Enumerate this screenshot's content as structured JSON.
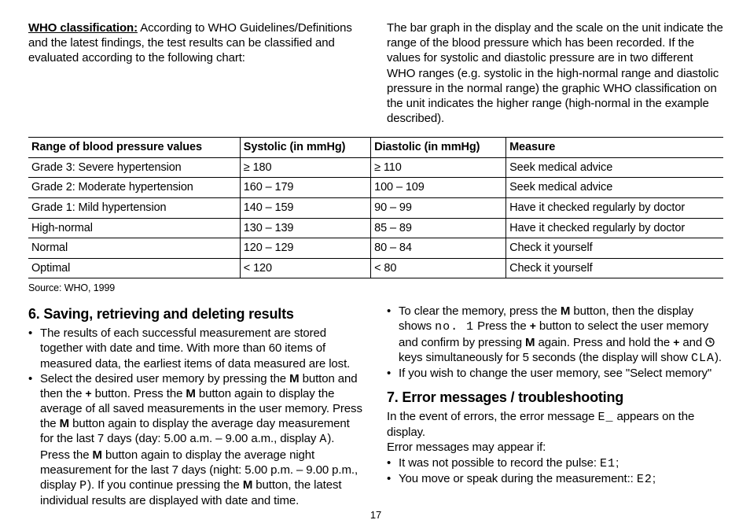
{
  "intro": {
    "who_heading": "WHO classification:",
    "who_body": "According to WHO Guidelines/Definitions and the latest findings, the test results can be classified and evaluated according to the following chart:",
    "right_body": "The bar graph in the display and the scale on the unit indicate the range of the blood pressure which has been recorded. If the values for systolic and diastolic pressure are in two different WHO ranges (e.g. systolic in the high-normal range and diastolic pressure in the normal range) the graphic WHO classification on the unit indicates the higher range (high-normal in the example described)."
  },
  "table": {
    "headers": {
      "range": "Range of blood pressure values",
      "systolic": "Systolic (in mmHg)",
      "diastolic": "Diastolic (in mmHg)",
      "measure": "Measure"
    },
    "rows": [
      {
        "range": "Grade 3: Severe hypertension",
        "systolic": "≥ 180",
        "diastolic": "≥ 110",
        "measure": "Seek medical advice"
      },
      {
        "range": "Grade 2: Moderate hypertension",
        "systolic": "160 – 179",
        "diastolic": "100 – 109",
        "measure": "Seek medical advice"
      },
      {
        "range": "Grade 1: Mild hypertension",
        "systolic": "140 – 159",
        "diastolic": "90 – 99",
        "measure": "Have it checked regularly by doctor"
      },
      {
        "range": "High-normal",
        "systolic": "130 – 139",
        "diastolic": "85 – 89",
        "measure": "Have it checked regularly by doctor"
      },
      {
        "range": "Normal",
        "systolic": "120 – 129",
        "diastolic": "80 – 84",
        "measure": "Check it yourself"
      },
      {
        "range": "Optimal",
        "systolic": "< 120",
        "diastolic": "< 80",
        "measure": "Check it yourself"
      }
    ],
    "source": "Source: WHO, 1999"
  },
  "section6": {
    "title": "6. Saving, retrieving and deleting results",
    "bullets": {
      "b1": "The results of each successful measurement are stored together with date and time. With more than 60 items of measured data, the earliest items of data measured are lost.",
      "b2": {
        "t1": "Select the desired user memory by pressing the ",
        "m1": "M",
        "t2": " button and then the ",
        "p1": "+",
        "t3": " button. Press the ",
        "m2": "M",
        "t4": " button again to display the average of all saved measurements in the user memory. Press the ",
        "m3": "M",
        "t5": " button again to display the average day measurement for the last 7 days (day: 5.00 a.m. – 9.00 a.m., display ",
        "disp1": "A",
        "t6": "). Press the ",
        "m4": "M",
        "t7": " button again to display the average night measurement for the last 7 days (night: 5.00 p.m. – 9.00 p.m., display ",
        "disp2": "P",
        "t8": "). If you continue pressing the ",
        "m5": "M",
        "t9": " button, the latest individual results are displayed with date and time."
      },
      "b3": {
        "t1": "To clear the memory, press the ",
        "m1": "M",
        "t2": " button, then the display shows ",
        "seg1": "no. 1",
        "t3": " Press the ",
        "p1": "+",
        "t4": " button to select the user memory and confirm by pressing ",
        "m2": "M",
        "t5": " again. Press and hold the ",
        "p2": "+",
        "t6": " and ",
        "t7": " keys simultaneously for 5 seconds (the display will show ",
        "seg2": "CLA",
        "t8": ")."
      },
      "b4": "If you wish to change the user memory, see \"Select memory\""
    }
  },
  "section7": {
    "title": "7. Error messages / troubleshooting",
    "intro": {
      "t1": "In the event of errors, the error message ",
      "e": "E_",
      "t2": " appears on the display."
    },
    "line2": "Error messages may appear if:",
    "bullets": {
      "b1": {
        "t1": "It was not possible to record the pulse: ",
        "e": "E1",
        "t2": ";"
      },
      "b2": {
        "t1": "You move or speak during the measurement:: ",
        "e": "E2",
        "t2": ";"
      }
    }
  },
  "page_number": "17"
}
